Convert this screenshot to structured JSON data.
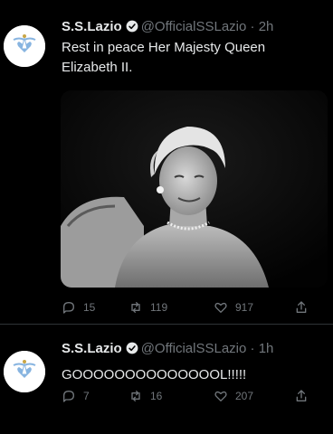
{
  "tweets": [
    {
      "account_name": "S.S.Lazio",
      "handle": "@OfficialSSLazio",
      "separator": "·",
      "time": "2h",
      "text": "Rest in peace Her Majesty Queen\nElizabeth II.",
      "has_photo": true,
      "counts": {
        "replies": "15",
        "retweets": "119",
        "likes": "917"
      }
    },
    {
      "account_name": "S.S.Lazio",
      "handle": "@OfficialSSLazio",
      "separator": "·",
      "time": "1h",
      "text": "GOOOOOOOOOOOOOOL!!!!!",
      "has_photo": false,
      "counts": {
        "replies": "7",
        "retweets": "16",
        "likes": "207"
      }
    }
  ],
  "icons": {
    "verified": "verified-badge-icon",
    "reply": "reply-icon",
    "retweet": "retweet-icon",
    "like": "heart-icon",
    "share": "share-icon"
  },
  "colors": {
    "background": "#000000",
    "text": "#e7e9ea",
    "secondary": "#71767b",
    "lazio_blue": "#87b4e0",
    "verified": "#1d9bf0"
  }
}
